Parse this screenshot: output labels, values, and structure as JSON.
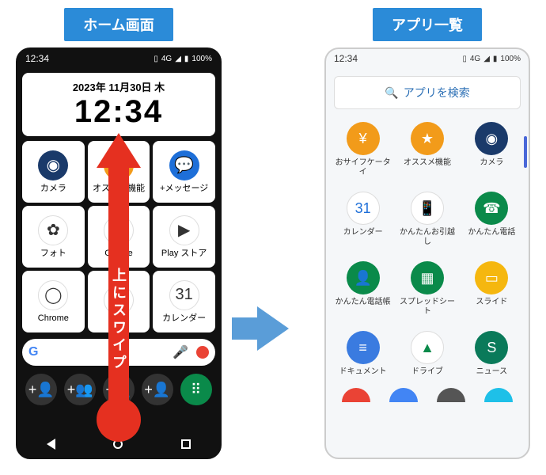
{
  "banners": {
    "left": "ホーム画面",
    "right": "アプリ一覧"
  },
  "status": {
    "time": "12:34",
    "net": "4G",
    "batt": "100%"
  },
  "clock": {
    "date": "2023年 11月30日 木",
    "time": "12:34"
  },
  "swipe_text": "上にスワイプ",
  "home_apps": [
    {
      "label": "カメラ",
      "color": "#1a3a6a",
      "glyph": "◉"
    },
    {
      "label": "オススメ機能",
      "color": "#f29b1a",
      "glyph": "★"
    },
    {
      "label": "+メッセージ",
      "color": "#1e6fd8",
      "glyph": "💬"
    },
    {
      "label": "フォト",
      "color": "#fff",
      "glyph": "✿"
    },
    {
      "label": "Google",
      "color": "#fff",
      "glyph": "G"
    },
    {
      "label": "Play ストア",
      "color": "#fff",
      "glyph": "▶"
    },
    {
      "label": "Chrome",
      "color": "#fff",
      "glyph": "◯"
    },
    {
      "label": "",
      "color": "#fff",
      "glyph": ""
    },
    {
      "label": "カレンダー",
      "color": "#fff",
      "glyph": "31"
    }
  ],
  "dock": [
    {
      "name": "contact-add-1",
      "glyph": "+👤"
    },
    {
      "name": "contact-add-2",
      "glyph": "+👥"
    },
    {
      "name": "contact-add-3",
      "glyph": "+👤"
    },
    {
      "name": "contact-add-4",
      "glyph": "+👤"
    },
    {
      "name": "dialer",
      "glyph": "⠿"
    }
  ],
  "search_apps_label": "アプリを検索",
  "app_list": [
    {
      "label": "おサイフケータイ",
      "color": "#f29b1a",
      "glyph": "¥"
    },
    {
      "label": "オススメ機能",
      "color": "#f29b1a",
      "glyph": "★"
    },
    {
      "label": "カメラ",
      "color": "#1a3a6a",
      "glyph": "◉"
    },
    {
      "label": "カレンダー",
      "color": "#ffffff",
      "glyph": "31",
      "fg": "#1e6fd8"
    },
    {
      "label": "かんたんお引越し",
      "color": "#ffffff",
      "glyph": "📱",
      "fg": "#555"
    },
    {
      "label": "かんたん電話",
      "color": "#0a8a4a",
      "glyph": "☎"
    },
    {
      "label": "かんたん電話帳",
      "color": "#0a8a4a",
      "glyph": "👤"
    },
    {
      "label": "スプレッドシート",
      "color": "#0a8a4a",
      "glyph": "▦"
    },
    {
      "label": "スライド",
      "color": "#f5b70f",
      "glyph": "▭"
    },
    {
      "label": "ドキュメント",
      "color": "#3a7be0",
      "glyph": "≡"
    },
    {
      "label": "ドライブ",
      "color": "#ffffff",
      "glyph": "▲",
      "fg": "#0a8a4a"
    },
    {
      "label": "ニュース",
      "color": "#0a7a5a",
      "glyph": "S"
    }
  ],
  "colors": {
    "banner": "#2b8bd8",
    "arrow": "#5a9dd8",
    "swipe": "#e53020"
  }
}
